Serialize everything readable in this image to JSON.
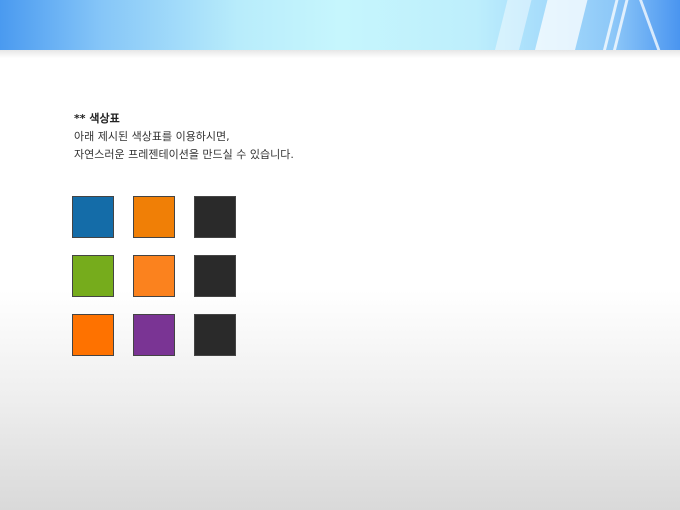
{
  "slide": {
    "title": "** 색상표",
    "line1": "아래 제시된 색상표를 이용하시면,",
    "line2": "자연스러운 프레젠테이션을 만드실 수 있습니다."
  },
  "palette": [
    [
      "#146ca8",
      "#f07f06",
      "#2a2a2a"
    ],
    [
      "#76ac1c",
      "#fb821e",
      "#2a2a2a"
    ],
    [
      "#fe7200",
      "#7a3494",
      "#2a2a2a"
    ]
  ]
}
